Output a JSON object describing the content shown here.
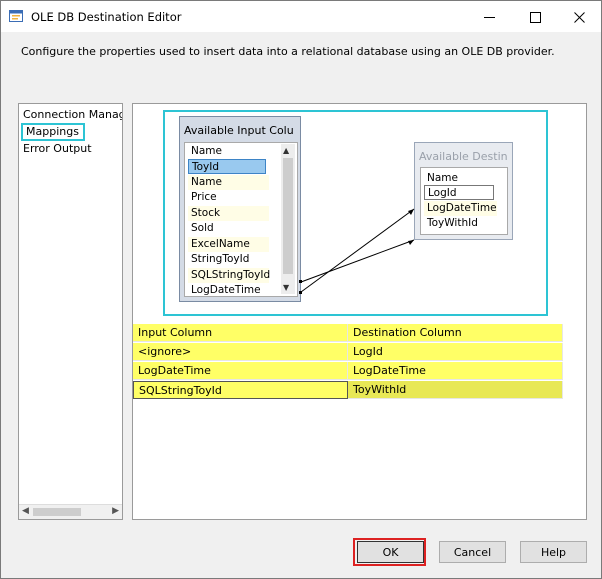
{
  "window": {
    "title": "OLE DB Destination Editor"
  },
  "description": "Configure the properties used to insert data into a relational database using an OLE DB provider.",
  "nav": {
    "items": [
      {
        "label": "Connection Manager",
        "selected": false
      },
      {
        "label": "Mappings",
        "selected": true
      },
      {
        "label": "Error Output",
        "selected": false
      }
    ]
  },
  "diagram": {
    "input_table": {
      "title": "Available Input Columns",
      "header": "Name",
      "columns": [
        "ToyId",
        "Name",
        "Price",
        "Stock",
        "Sold",
        "ExcelName",
        "StringToyId",
        "SQLStringToyId",
        "LogDateTime"
      ]
    },
    "destination_table": {
      "title": "Available Destination Columns",
      "header": "Name",
      "columns": [
        "LogId",
        "LogDateTime",
        "ToyWithId"
      ]
    }
  },
  "mappings": {
    "headers": {
      "input": "Input Column",
      "destination": "Destination Column"
    },
    "rows": [
      {
        "input": "<ignore>",
        "destination": "LogId"
      },
      {
        "input": "LogDateTime",
        "destination": "LogDateTime"
      },
      {
        "input": "SQLStringToyId",
        "destination": "ToyWithId"
      }
    ]
  },
  "buttons": {
    "ok": "OK",
    "cancel": "Cancel",
    "help": "Help"
  },
  "colors": {
    "highlight_cyan": "#2dc4d4",
    "mapping_yellow": "#ffff66",
    "ok_outline_red": "#dd2222",
    "selection_blue": "#99c9ef"
  }
}
